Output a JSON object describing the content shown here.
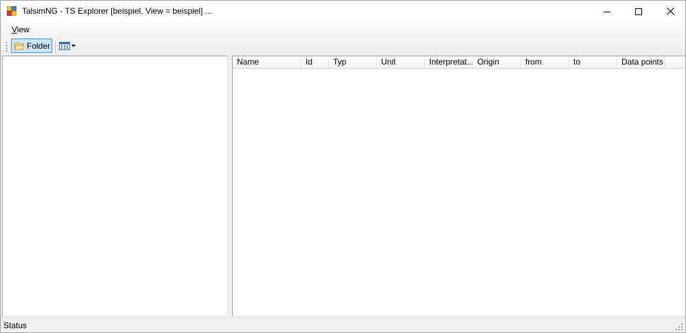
{
  "window": {
    "title": "TalsimNG - TS Explorer [beispiel, View = beispiel] ..."
  },
  "menu": {
    "items": [
      {
        "access_key": "V",
        "rest": "iew"
      }
    ]
  },
  "toolbar": {
    "folder_label": "Folder"
  },
  "list": {
    "columns": [
      "Name",
      "Id",
      "Typ",
      "Unit",
      "Interpretat...",
      "Origin",
      "from",
      "to",
      "Data points"
    ]
  },
  "status": {
    "text": "Status"
  },
  "icons": {
    "app": "talsim-app-icon",
    "folder": "folder-icon",
    "view_mode": "details-view-icon",
    "dropdown": "dropdown-arrow-icon"
  },
  "colors": {
    "selected_button_bg": "#cce4f7",
    "selected_button_border": "#3399ff"
  }
}
